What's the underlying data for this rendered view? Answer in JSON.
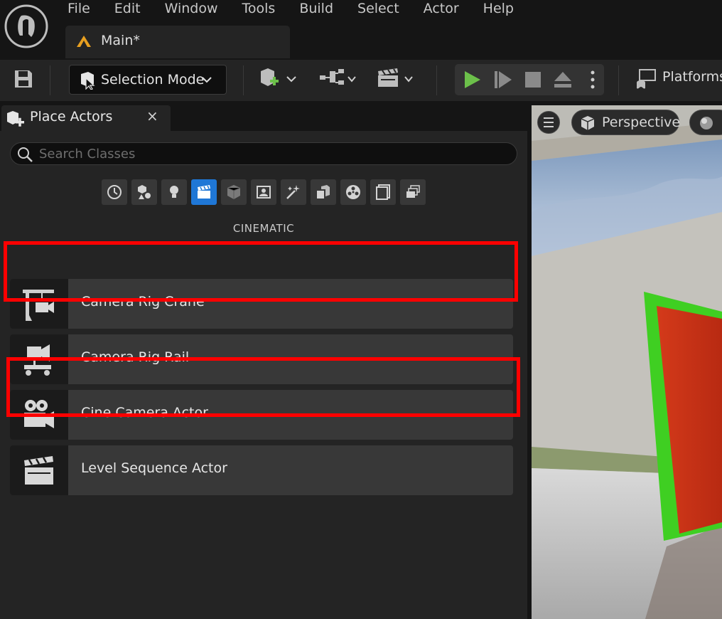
{
  "menu": {
    "items": [
      "File",
      "Edit",
      "Window",
      "Tools",
      "Build",
      "Select",
      "Actor",
      "Help"
    ]
  },
  "level_tab": {
    "label": "Main*"
  },
  "toolbar": {
    "selection_mode_label": "Selection Mode",
    "platforms_label": "Platforms"
  },
  "place_actors": {
    "tab_label": "Place Actors",
    "close_glyph": "×",
    "search_placeholder": "Search Classes",
    "categories": [
      {
        "icon": "recent-clock-icon",
        "active": false
      },
      {
        "icon": "basic-shapes-icon",
        "active": false
      },
      {
        "icon": "lights-bulb-icon",
        "active": false
      },
      {
        "icon": "cinematic-clapper-icon",
        "active": true
      },
      {
        "icon": "visual-effects-cube-icon",
        "active": false
      },
      {
        "icon": "geometry-icon",
        "active": false
      },
      {
        "icon": "effects-sparkle-icon",
        "active": false
      },
      {
        "icon": "volumes-icon",
        "active": false
      },
      {
        "icon": "all-classes-icon",
        "active": false
      },
      {
        "icon": "pages-icon",
        "active": false
      },
      {
        "icon": "stack-icon",
        "active": false
      }
    ],
    "category_title": "CINEMATIC",
    "actors": [
      {
        "label": "Camera Rig Crane",
        "icon": "camera-crane-icon"
      },
      {
        "label": "Camera Rig Rail",
        "icon": "camera-rail-icon"
      },
      {
        "label": "Cine Camera Actor",
        "icon": "cine-camera-icon"
      },
      {
        "label": "Level Sequence Actor",
        "icon": "clapperboard-icon"
      }
    ]
  },
  "viewport": {
    "view_mode_label": "Perspective"
  },
  "colors": {
    "accent": "#1f77d6",
    "highlight": "#ff0000",
    "play": "#6cc04a"
  }
}
